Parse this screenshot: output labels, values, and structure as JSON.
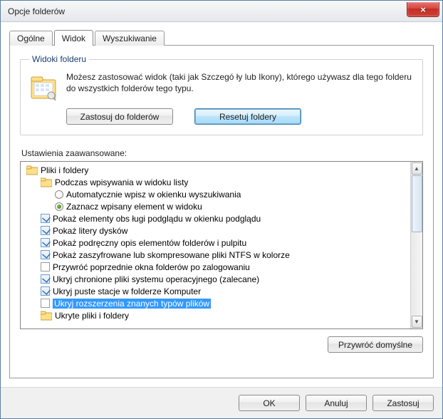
{
  "window": {
    "title": "Opcje folderów"
  },
  "tabs": {
    "general": "Ogólne",
    "view": "Widok",
    "search": "Wyszukiwanie",
    "active": "view"
  },
  "folderViews": {
    "legend": "Widoki folderu",
    "desc": "Możesz zastosować widok (taki jak Szczegó ły lub Ikony), którego używasz dla tego folderu do wszystkich folderów tego typu.",
    "applyButton": "Zastosuj do folderów",
    "resetButton": "Resetuj foldery"
  },
  "advanced": {
    "label": "Ustawienia zaawansowane:",
    "rootLabel": "Pliki i foldery",
    "typingGroup": {
      "label": "Podczas wpisywania w widoku listy",
      "optAuto": "Automatycznie wpisz w okienku wyszukiwania",
      "optSelect": "Zaznacz wpisany element w widoku",
      "selected": "optSelect"
    },
    "items": [
      {
        "key": "preview",
        "label": "Pokaż elementy obs ługi podglądu w okienku podglądu",
        "checked": true
      },
      {
        "key": "driveletters",
        "label": "Pokaż litery dysków",
        "checked": true
      },
      {
        "key": "popup",
        "label": "Pokaż podręczny opis elementów folderów i pulpitu",
        "checked": true
      },
      {
        "key": "ntfscolor",
        "label": "Pokaż zaszyfrowane lub skompresowane pliki NTFS w kolorze",
        "checked": true
      },
      {
        "key": "restorewin",
        "label": "Przywróć poprzednie okna folderów po zalogowaniu",
        "checked": false
      },
      {
        "key": "hideos",
        "label": "Ukryj chronione pliki systemu operacyjnego (zalecane)",
        "checked": true
      },
      {
        "key": "hidedrives",
        "label": "Ukryj puste stacje w folderze Komputer",
        "checked": true
      },
      {
        "key": "hideext",
        "label": "Ukryj rozszerzenia znanych typów plików",
        "checked": false,
        "selected": true
      },
      {
        "key": "hiddengroup",
        "label": "Ukryte pliki i foldery",
        "isGroup": true
      }
    ],
    "restoreDefaults": "Przywróć domyślne"
  },
  "dialogButtons": {
    "ok": "OK",
    "cancel": "Anuluj",
    "apply": "Zastosuj"
  }
}
